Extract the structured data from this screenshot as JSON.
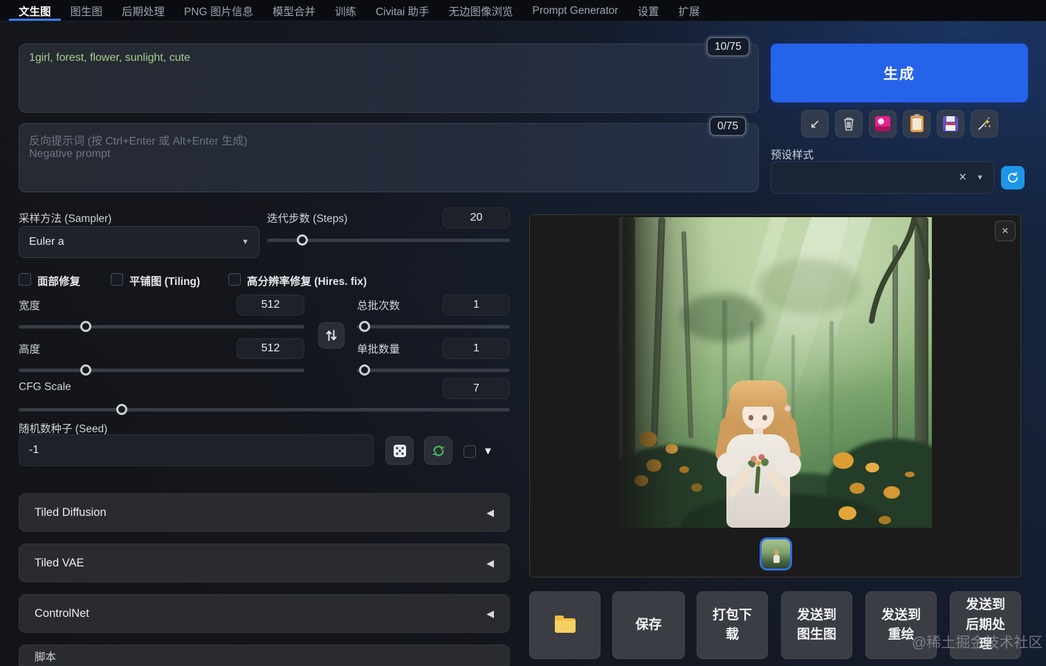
{
  "nav": {
    "tabs": [
      {
        "label": "文生图",
        "active": true
      },
      {
        "label": "图生图"
      },
      {
        "label": "后期处理"
      },
      {
        "label": "PNG 图片信息"
      },
      {
        "label": "模型合并"
      },
      {
        "label": "训练"
      },
      {
        "label": "Civitai 助手"
      },
      {
        "label": "无边图像浏览"
      },
      {
        "label": "Prompt Generator"
      },
      {
        "label": "设置"
      },
      {
        "label": "扩展"
      }
    ]
  },
  "prompt": {
    "value": "1girl, forest, flower, sunlight, cute",
    "counter": "10/75"
  },
  "negative": {
    "placeholder": "反向提示词 (按 Ctrl+Enter 或 Alt+Enter 生成)\nNegative prompt",
    "counter": "0/75"
  },
  "params": {
    "sampler_label": "采样方法 (Sampler)",
    "sampler_value": "Euler a",
    "steps_label": "迭代步数 (Steps)",
    "steps_value": "20",
    "restore_faces_label": "面部修复",
    "tiling_label": "平铺图 (Tiling)",
    "hires_fix_label": "高分辨率修复 (Hires. fix)",
    "width_label": "宽度",
    "width_value": "512",
    "height_label": "高度",
    "height_value": "512",
    "batch_count_label": "总批次数",
    "batch_count_value": "1",
    "batch_size_label": "单批数量",
    "batch_size_value": "1",
    "cfg_label": "CFG Scale",
    "cfg_value": "7",
    "seed_label": "随机数种子 (Seed)",
    "seed_value": "-1"
  },
  "sections": {
    "tiled_diffusion": "Tiled Diffusion",
    "tiled_vae": "Tiled VAE",
    "controlnet": "ControlNet",
    "script": "脚本"
  },
  "right": {
    "generate_label": "生成",
    "styles_label": "预设样式"
  },
  "output": {
    "save": "保存",
    "zip": "打包下载",
    "send_img2img": "发送到图生图",
    "send_inpaint": "发送到重绘",
    "send_extras": "发送到后期处理"
  },
  "watermark": "@稀土掘金技术社区",
  "icons": {
    "dropdown_arrow": "▼",
    "collapse_arrow": "◀",
    "close": "×",
    "read_params_arrow": "↙"
  },
  "colors": {
    "accent_blue": "#2563eb",
    "tab_underline": "#3d7eff",
    "prompt_text_green": "#a4cf88",
    "refresh_button_blue": "#1d96e8",
    "thumbnail_border_blue": "#2f6fe4",
    "folder_yellow": "#efbe3d"
  }
}
